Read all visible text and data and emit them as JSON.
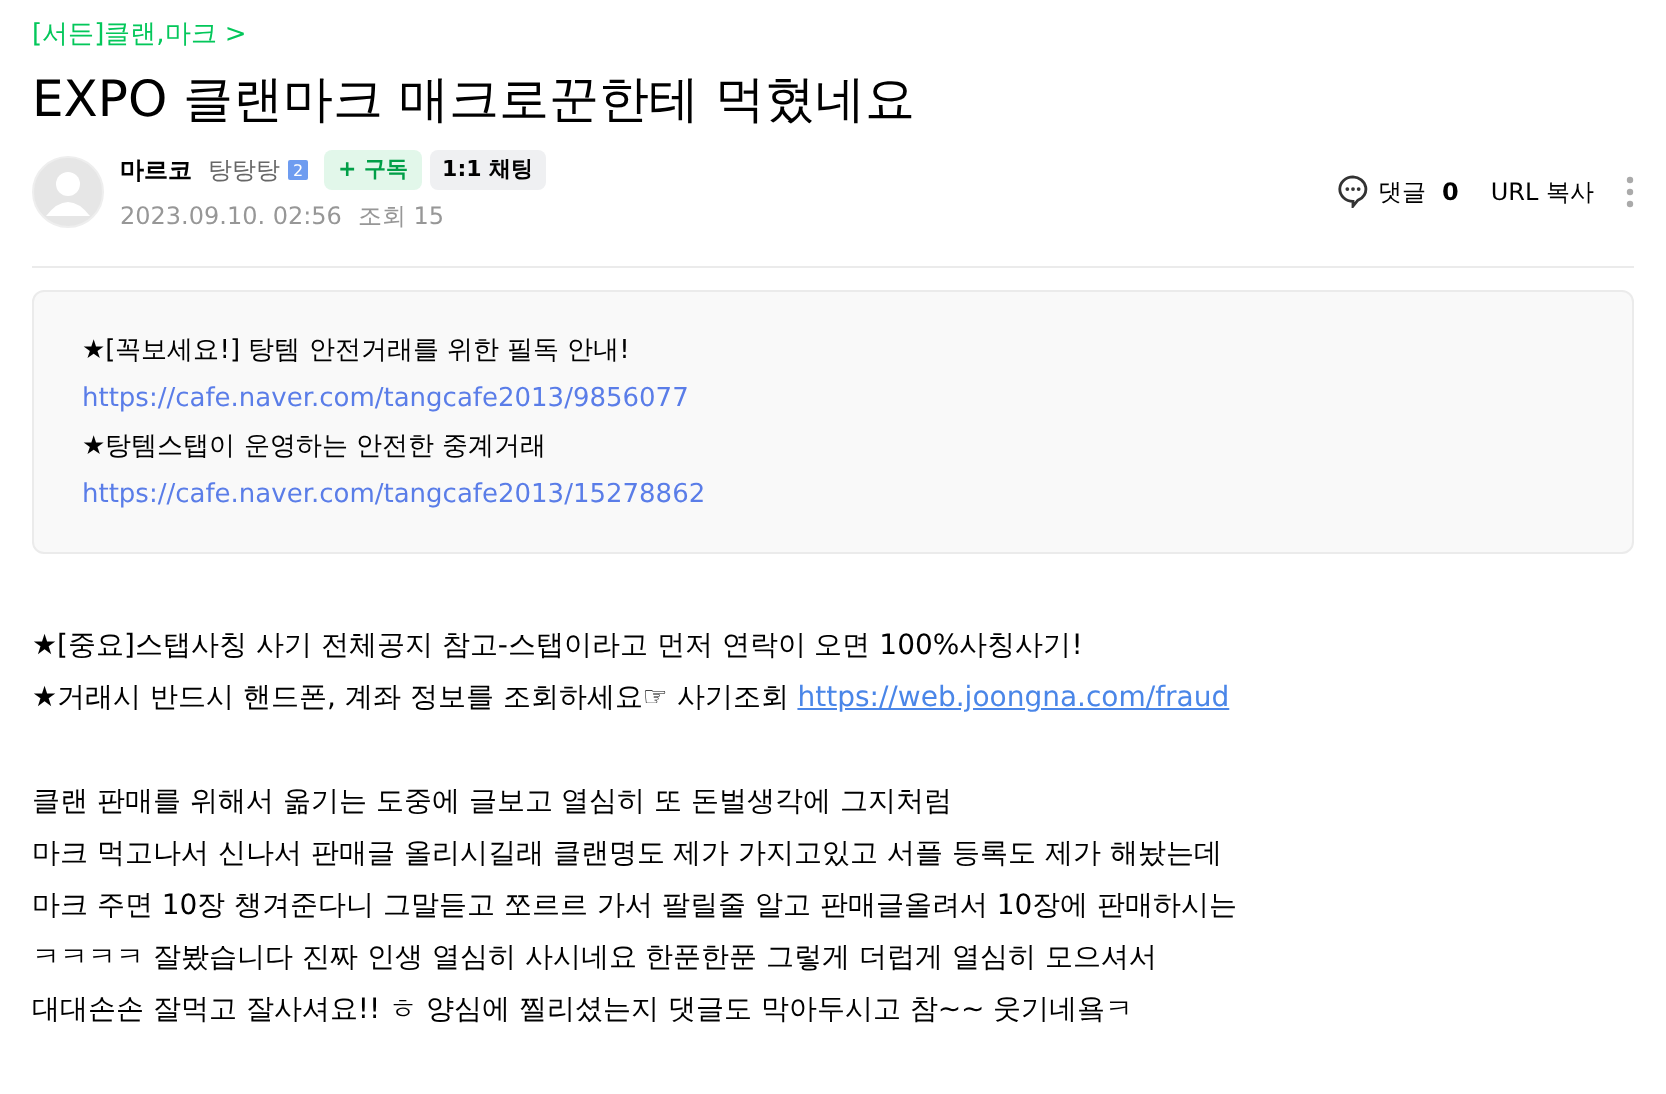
{
  "breadcrumb": {
    "label": "[서든]클랜,마크",
    "arrow": ">"
  },
  "title": "EXPO 클랜마크 매크로꾼한테 먹혔네요",
  "author": {
    "name": "마르코",
    "level_name": "탕탕탕",
    "level_badge": "2",
    "subscribe": "+ 구독",
    "chat": "1:1 채팅",
    "date": "2023.09.10. 02:56",
    "views_label": "조회 15"
  },
  "actions": {
    "comments_label": "댓글",
    "comments_count": "0",
    "url_copy": "URL 복사"
  },
  "notice": [
    {
      "kind": "text",
      "text": "★[꼭보세요!] 탕템 안전거래를 위한 필독 안내!"
    },
    {
      "kind": "link",
      "text": "https://cafe.naver.com/tangcafe2013/9856077"
    },
    {
      "kind": "text",
      "text": "★탕템스탭이 운영하는 안전한 중계거래"
    },
    {
      "kind": "link",
      "text": "https://cafe.naver.com/tangcafe2013/15278862"
    }
  ],
  "body": [
    {
      "text": "★[중요]스탭사칭 사기 전체공지 참고-스탭이라고 먼저 연락이 오면 100%사칭사기!"
    },
    {
      "text": "★거래시 반드시 핸드폰, 계좌 정보를 조회하세요☞ 사기조회",
      "link": "https://web.joongna.com/fraud"
    },
    {
      "kind": "blank"
    },
    {
      "text": "클랜 판매를 위해서 옮기는 도중에 글보고 열심히 또 돈벌생각에 그지처럼"
    },
    {
      "text": "마크 먹고나서 신나서 판매글 올리시길래 클랜명도 제가 가지고있고 서플 등록도 제가 해놨는데"
    },
    {
      "text": "마크 주면 10장 챙겨준다니 그말듣고 쪼르르 가서 팔릴줄 알고 판매글올려서 10장에 판매하시는"
    },
    {
      "text": "ㅋㅋㅋㅋ 잘봤습니다 진짜 인생 열심히 사시네요 한푼한푼 그렇게 더럽게 열심히 모으셔서"
    },
    {
      "text": "대대손손 잘먹고 잘사셔요!! ㅎ 양심에 찔리셨는지 댓글도 막아두시고 참~~ 웃기네욬ㅋ"
    }
  ]
}
